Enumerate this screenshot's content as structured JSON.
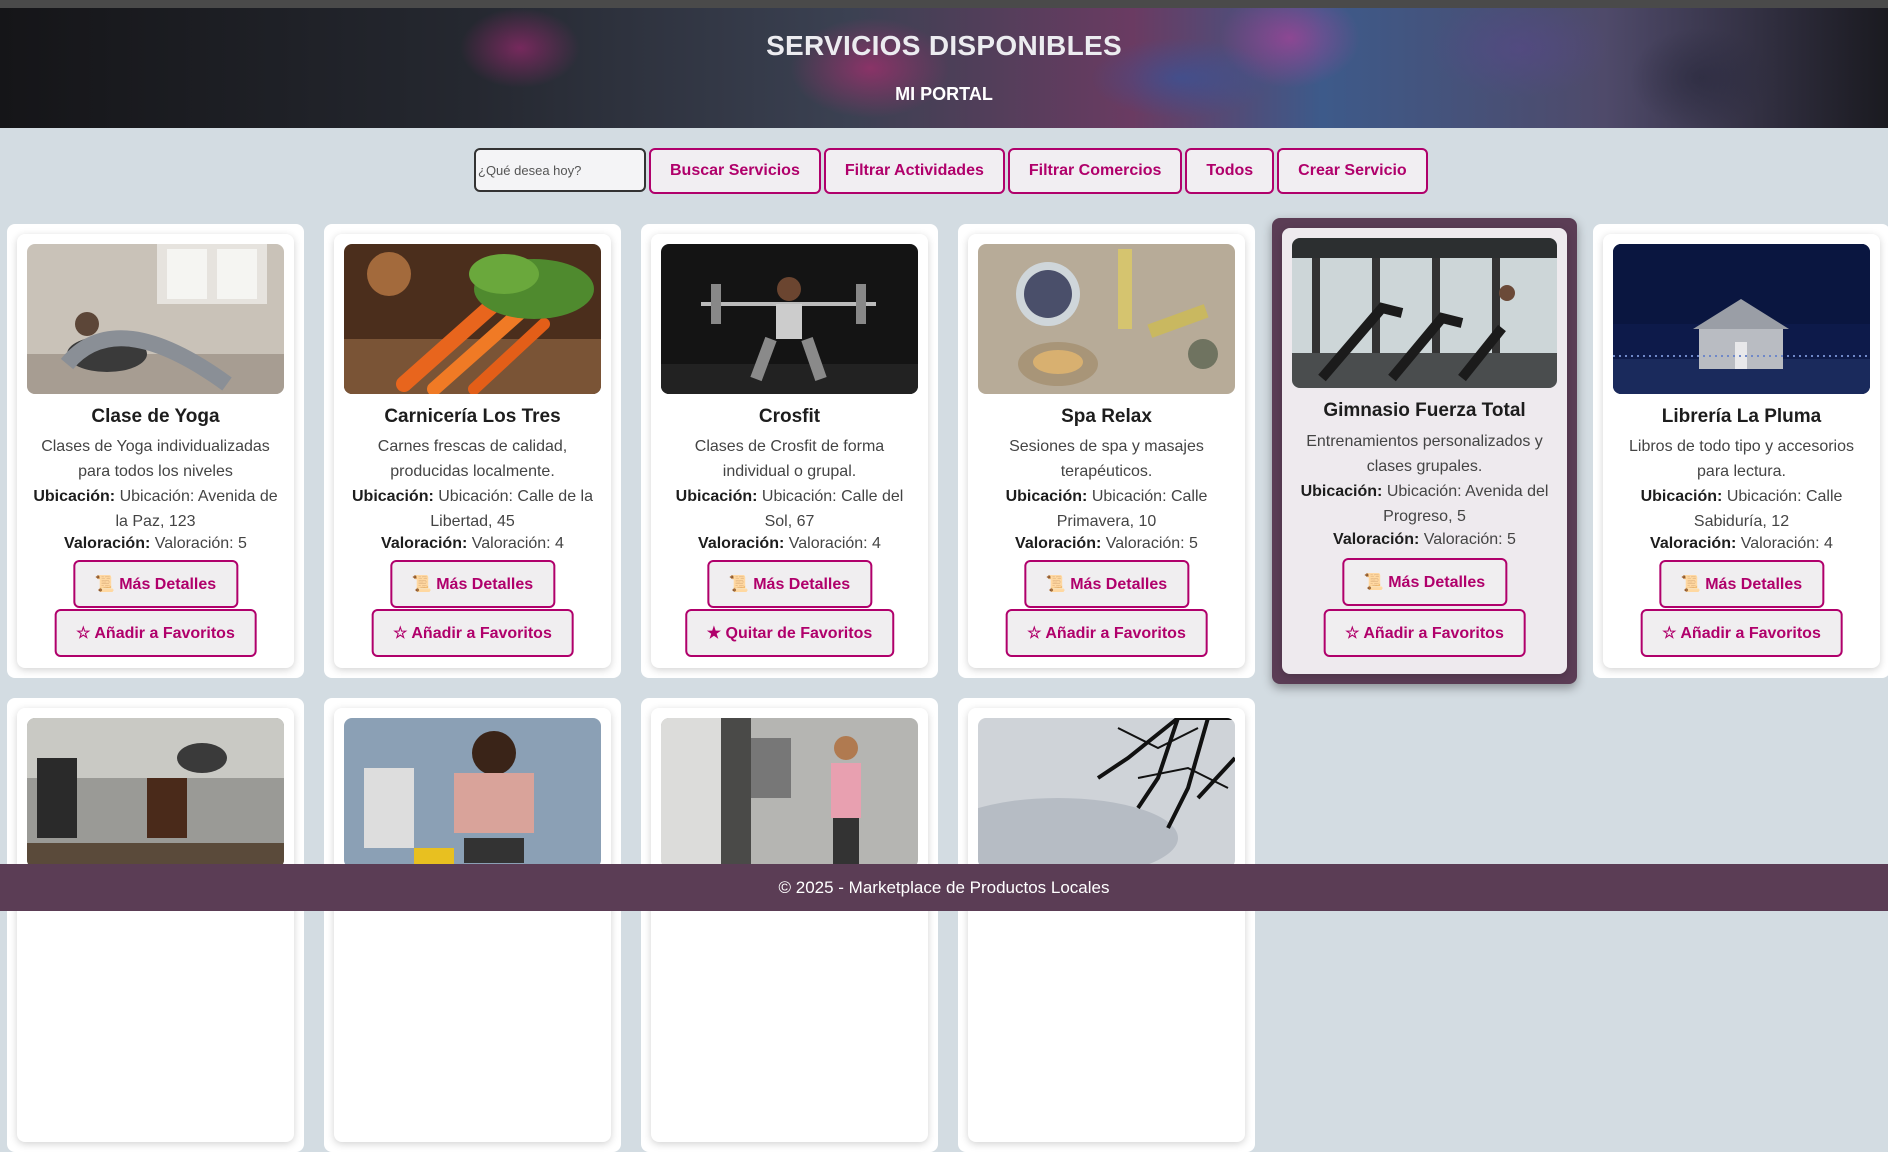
{
  "header": {
    "title": "SERVICIOS DISPONIBLES",
    "subtitle": "MI PORTAL"
  },
  "toolbar": {
    "search_placeholder": "¿Qué desea hoy?",
    "buttons": [
      "Buscar Servicios",
      "Filtrar Actividades",
      "Filtrar Comercios",
      "Todos",
      "Crear Servicio"
    ]
  },
  "labels": {
    "location": "Ubicación:",
    "rating": "Valoración:"
  },
  "colors": {
    "accent": "#b0006b",
    "footer": "#5b3d55",
    "background": "#d3dce2"
  },
  "cards": [
    {
      "title": "Clase de Yoga",
      "desc": "Clases de Yoga individualizadas para todos los niveles",
      "location": "Ubicación: Avenida de la Paz, 123",
      "rating": "Valoración: 5",
      "details": "📜 Más Detalles",
      "fav": "☆ Añadir a Favoritos",
      "image": "yoga-photo"
    },
    {
      "title": "Carnicería Los Tres",
      "desc": "Carnes frescas de calidad, producidas localmente.",
      "location": "Ubicación: Calle de la Libertad, 45",
      "rating": "Valoración: 4",
      "details": "📜 Más Detalles",
      "fav": "☆ Añadir a Favoritos",
      "image": "carrots-photo"
    },
    {
      "title": "Crosfit",
      "desc": "Clases de Crosfit de forma individual o grupal.",
      "location": "Ubicación: Calle del Sol, 67",
      "rating": "Valoración: 4",
      "details": "📜 Más Detalles",
      "fav": "★ Quitar de Favoritos",
      "image": "weightlifting-photo"
    },
    {
      "title": "Spa Relax",
      "desc": "Sesiones de spa y masajes terapéuticos.",
      "location": "Ubicación: Calle Primavera, 10",
      "rating": "Valoración: 5",
      "details": "📜 Más Detalles",
      "fav": "☆ Añadir a Favoritos",
      "image": "spa-photo"
    },
    {
      "title": "Gimnasio Fuerza Total",
      "desc": "Entrenamientos personalizados y clases grupales.",
      "location": "Ubicación: Avenida del Progreso, 5",
      "rating": "Valoración: 5",
      "details": "📜 Más Detalles",
      "fav": "☆ Añadir a Favoritos",
      "image": "gym-photo"
    },
    {
      "title": "Librería La Pluma",
      "desc": "Libros de todo tipo y accesorios para lectura.",
      "location": "Ubicación: Calle Sabiduría, 12",
      "rating": "Valoración: 4",
      "details": "📜 Más Detalles",
      "fav": "☆ Añadir a Favoritos",
      "image": "house-night-photo"
    },
    {
      "image": "coffee-photo"
    },
    {
      "image": "painting-photo"
    },
    {
      "image": "anechoic-room-photo"
    },
    {
      "image": "tree-sky-photo"
    }
  ],
  "footer": {
    "text": "© 2025 - Marketplace de Productos Locales"
  }
}
